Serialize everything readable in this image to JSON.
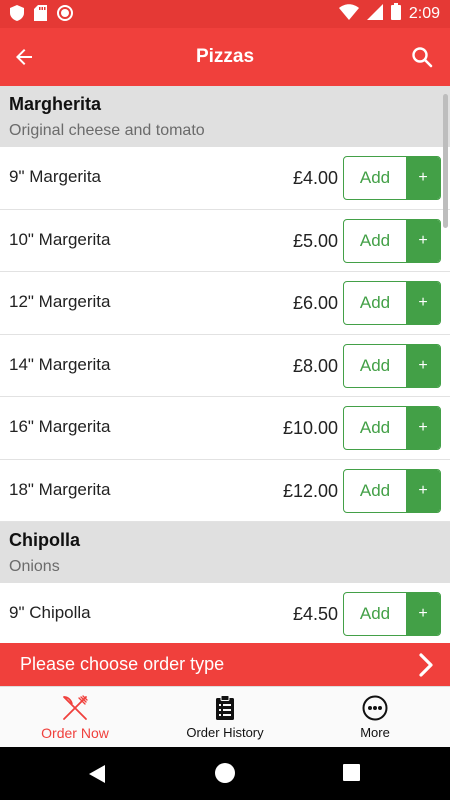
{
  "status_bar": {
    "time": "2:09"
  },
  "app_bar": {
    "title": "Pizzas"
  },
  "sections": [
    {
      "name": "Margherita",
      "description": "Original cheese and tomato",
      "items": [
        {
          "name": "9\" Margerita",
          "price": "£4.00"
        },
        {
          "name": "10\" Margerita",
          "price": "£5.00"
        },
        {
          "name": "12\" Margerita",
          "price": "£6.00"
        },
        {
          "name": "14\" Margerita",
          "price": "£8.00"
        },
        {
          "name": "16\" Margerita",
          "price": "£10.00"
        },
        {
          "name": "18\" Margerita",
          "price": "£12.00"
        }
      ]
    },
    {
      "name": "Chipolla",
      "description": "Onions",
      "items": [
        {
          "name": "9\" Chipolla",
          "price": "£4.50"
        }
      ]
    }
  ],
  "add_button": {
    "label": "Add",
    "plus": "+"
  },
  "order_type_bar": {
    "text": "Please choose order type"
  },
  "bottom_nav": {
    "items": [
      {
        "label": "Order Now",
        "icon": "fork-knife-icon",
        "active": true
      },
      {
        "label": "Order History",
        "icon": "clipboard-icon",
        "active": false
      },
      {
        "label": "More",
        "icon": "more-dots-icon",
        "active": false
      }
    ]
  },
  "colors": {
    "primary": "#f0403c",
    "status_bar": "#e53935",
    "accent_green": "#43a047",
    "section_bg": "#e0e0e0"
  }
}
